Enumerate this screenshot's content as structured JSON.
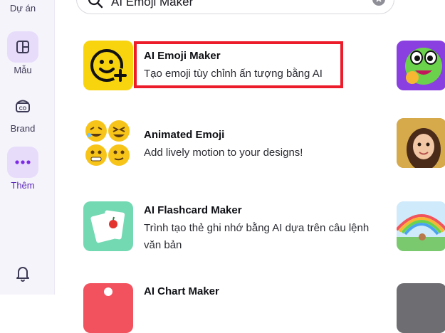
{
  "sidebar": {
    "items": [
      {
        "label": "Dự án",
        "icon": "folder-icon"
      },
      {
        "label": "Mẫu",
        "icon": "template-icon"
      },
      {
        "label": "Brand",
        "icon": "brand-icon"
      },
      {
        "label": "Thêm",
        "icon": "more-icon"
      }
    ],
    "bottom_icon": "bell-icon"
  },
  "search": {
    "value": "AI Emoji Maker"
  },
  "apps": [
    {
      "title": "AI Emoji Maker",
      "description": "Tạo emoji tùy chỉnh ấn tượng bằng AI"
    },
    {
      "title": "Animated Emoji",
      "description": "Add lively motion to your designs!"
    },
    {
      "title": "AI Flashcard Maker",
      "description": "Trình tạo thẻ ghi nhớ bằng AI dựa trên câu lệnh văn bản"
    },
    {
      "title": "AI Chart Maker",
      "description": ""
    }
  ],
  "colors": {
    "accent": "#7d2ae8",
    "highlight": "#ed1c2b",
    "sidebar_bg": "#f6f4fb"
  }
}
